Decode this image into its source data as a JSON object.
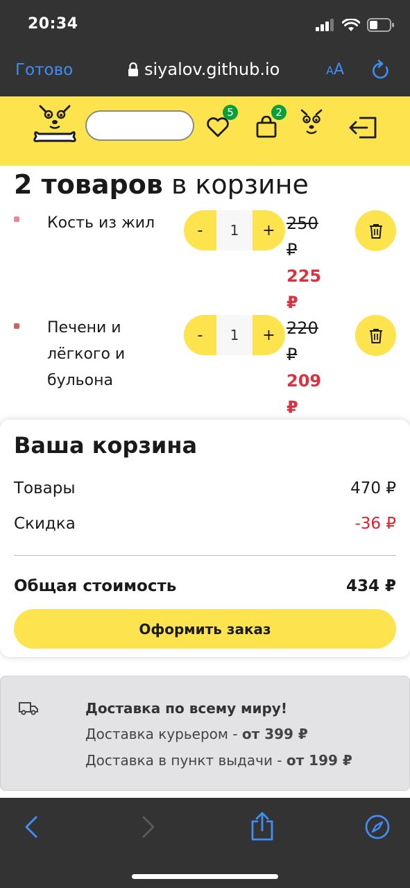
{
  "status_bar": {
    "time": "20:34"
  },
  "browser": {
    "done_label": "Готово",
    "url": "siyalov.github.io",
    "text_size_label_small": "A",
    "text_size_label_large": "A"
  },
  "header": {
    "favorites_count": "5",
    "cart_count": "2"
  },
  "cart": {
    "title_bold": "2 товаров",
    "title_rest": " в корзине",
    "items": [
      {
        "name": "Кость из жил",
        "quantity": "1",
        "minus_label": "-",
        "plus_label": "+",
        "old_price": "250 ₽",
        "new_price": "225 ₽"
      },
      {
        "name": "Печени и лёгкого и бульона",
        "quantity": "1",
        "minus_label": "-",
        "plus_label": "+",
        "old_price": "220 ₽",
        "new_price": "209 ₽"
      }
    ]
  },
  "summary": {
    "title": "Ваша корзина",
    "goods_label": "Товары",
    "goods_value": "470 ₽",
    "discount_label": "Скидка",
    "discount_value": "-36 ₽",
    "total_label": "Общая стоимость",
    "total_value": "434 ₽",
    "checkout_label": "Оформить заказ"
  },
  "delivery": {
    "title": "Доставка по всему миру!",
    "courier_label": "Доставка курьером - ",
    "courier_price": "от 399 ₽",
    "pickup_label": "Доставка в пункт выдачи - ",
    "pickup_price": "от 199 ₽"
  },
  "colors": {
    "accent_yellow": "#fde34d",
    "discount_red": "#d93240",
    "badge_green": "#0a9f3a",
    "ios_blue": "#3f8ef5"
  }
}
